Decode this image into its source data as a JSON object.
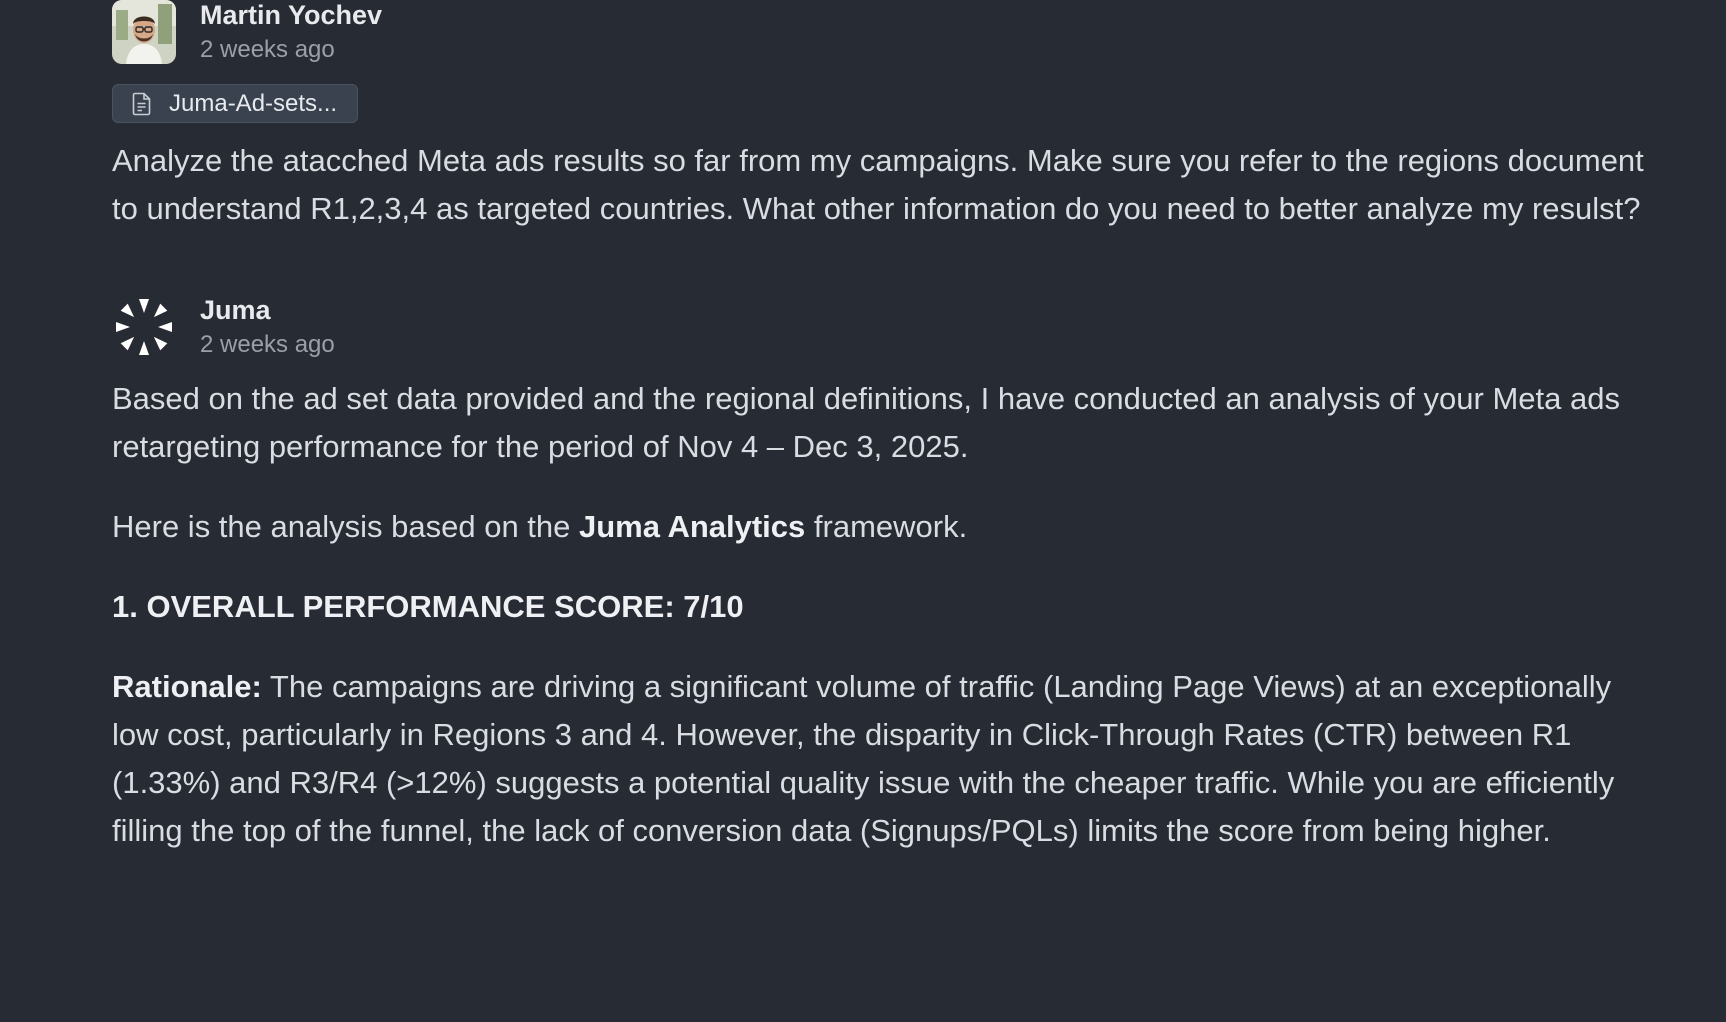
{
  "messages": [
    {
      "author": "Martin Yochev",
      "time": "2 weeks ago",
      "avatar_icon": "user-photo-avatar",
      "attachment": {
        "icon": "file-doc-icon",
        "label": "Juma-Ad-sets..."
      },
      "text": "Analyze the atacched Meta ads results so far from my campaigns. Make sure you refer to the regions document to understand R1,2,3,4 as targeted countries. What other information do you need to better analyze my resulst?"
    },
    {
      "author": "Juma",
      "time": "2 weeks ago",
      "avatar_icon": "juma-logo-icon",
      "intro": "Based on the ad set data provided and the regional definitions, I have conducted an analysis of your Meta ads retargeting performance for the period of Nov 4 – Dec 3, 2025.",
      "framework_prefix": "Here is the analysis based on the ",
      "framework_name": "Juma Analytics",
      "framework_suffix": " framework.",
      "section_heading": "1. OVERALL PERFORMANCE SCORE: 7/10",
      "rationale_label": "Rationale:",
      "rationale_text": " The campaigns are driving a significant volume of traffic (Landing Page Views) at an exceptionally low cost, particularly in Regions 3 and 4. However, the disparity in Click-Through Rates (CTR) between R1 (1.33%) and R3/R4 (>12%) suggests a potential quality issue with the cheaper traffic. While you are efficiently filling the top of the funnel, the lack of conversion data (Signups/PQLs) limits the score from being higher."
    }
  ],
  "colors": {
    "background": "#272b33",
    "text": "#d9dce1",
    "muted": "#9aa0a9",
    "chip": "#3a4250"
  }
}
